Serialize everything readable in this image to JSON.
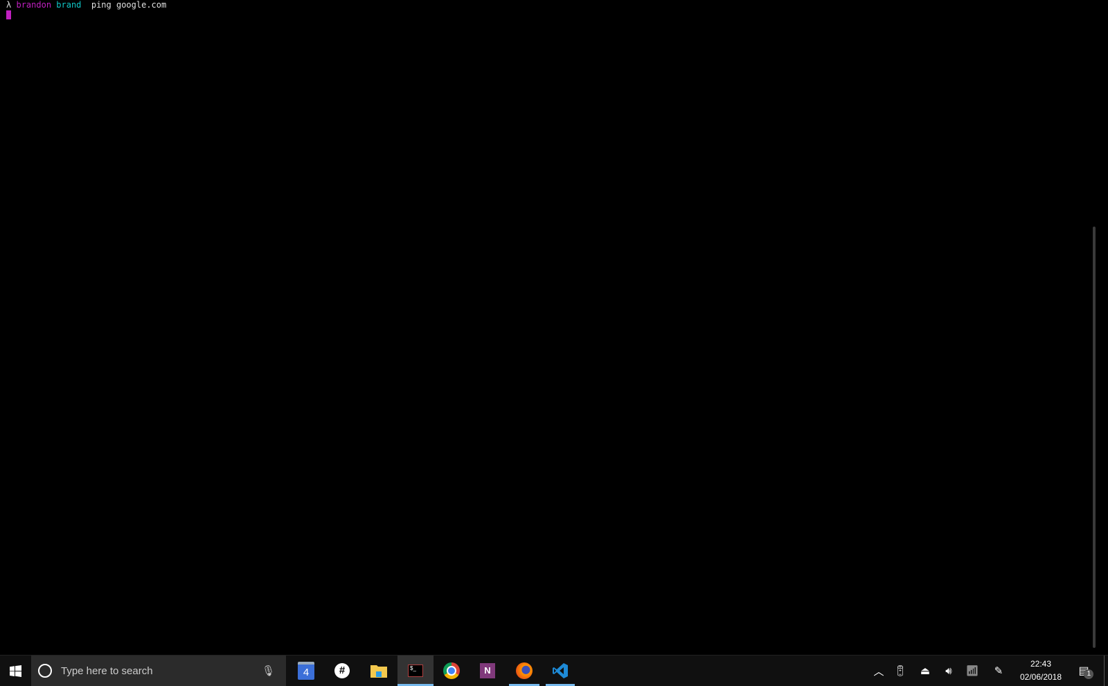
{
  "terminal": {
    "prompt_symbol": "λ",
    "user": "brandon",
    "host": "brand",
    "command": "ping google.com"
  },
  "taskbar": {
    "search_placeholder": "Type here to search",
    "apps": [
      {
        "name": "Google Calendar",
        "icon": "calendar-icon",
        "label": "4"
      },
      {
        "name": "Slack",
        "icon": "slack-icon"
      },
      {
        "name": "File Explorer",
        "icon": "folder-icon"
      },
      {
        "name": "Terminal",
        "icon": "terminal-icon",
        "active": true
      },
      {
        "name": "Chrome",
        "icon": "chrome-icon"
      },
      {
        "name": "OneNote",
        "icon": "onenote-icon",
        "label": "N"
      },
      {
        "name": "Firefox",
        "icon": "firefox-icon",
        "running": true
      },
      {
        "name": "VS Code",
        "icon": "vscode-icon",
        "running": true
      }
    ],
    "time": "22:43",
    "date": "02/06/2018",
    "notification_count": "1",
    "accent": "#76b9ed"
  }
}
